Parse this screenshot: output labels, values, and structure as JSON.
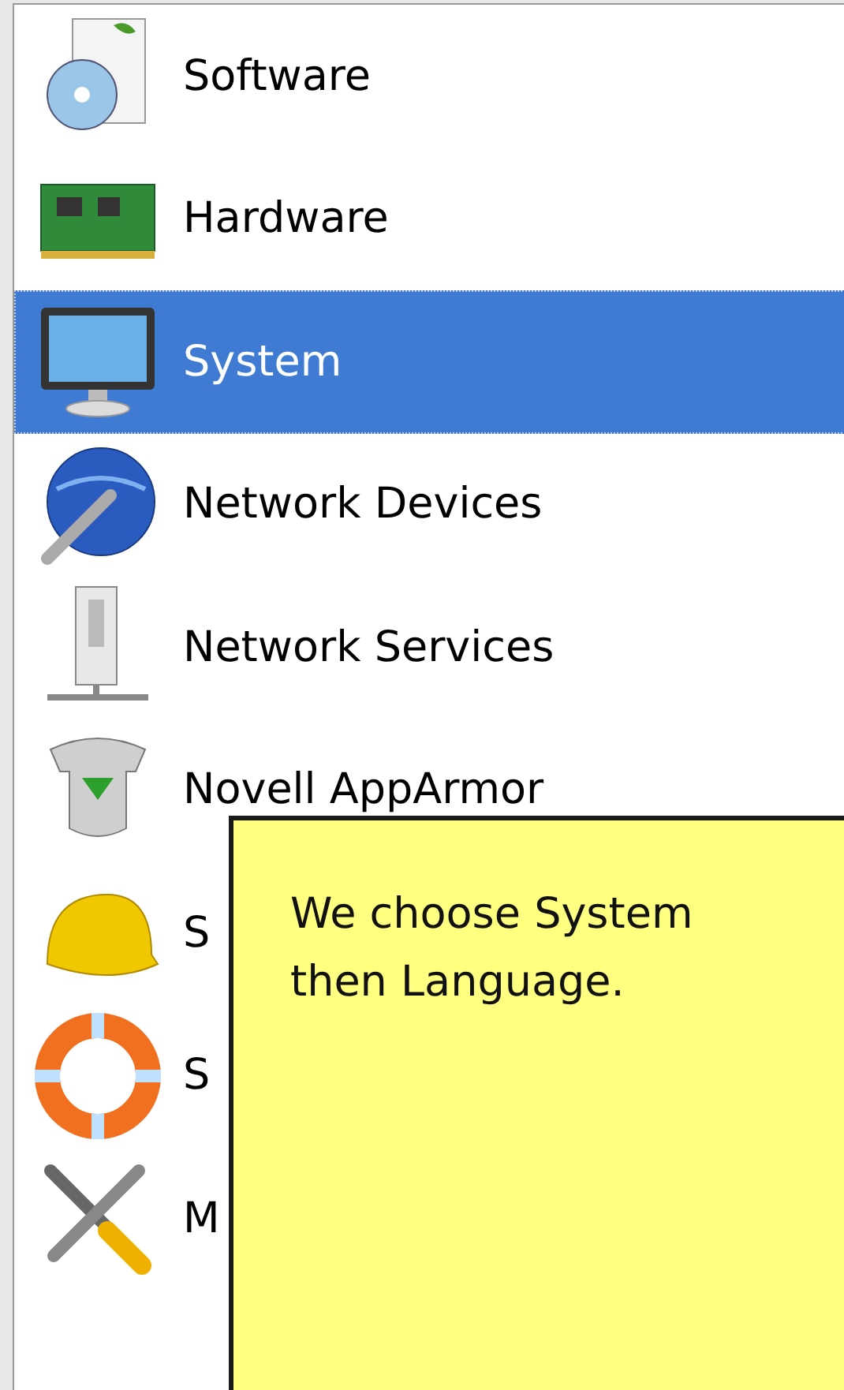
{
  "categories": [
    {
      "label": "Software",
      "selected": false
    },
    {
      "label": "Hardware",
      "selected": false
    },
    {
      "label": "System",
      "selected": true
    },
    {
      "label": "Network Devices",
      "selected": false
    },
    {
      "label": "Network Services",
      "selected": false
    },
    {
      "label": "Novell AppArmor",
      "selected": false
    },
    {
      "label": "S",
      "selected": false
    },
    {
      "label": "S",
      "selected": false
    },
    {
      "label": "M",
      "selected": false
    }
  ],
  "tooltip": {
    "lines": [
      "We choose System",
      "then Language."
    ]
  }
}
